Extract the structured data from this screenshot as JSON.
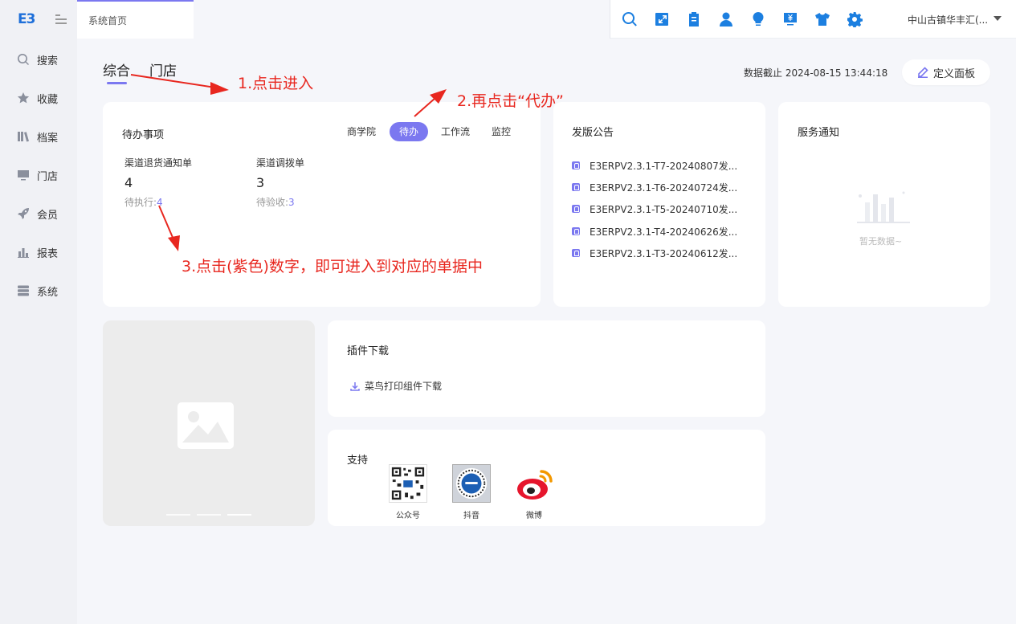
{
  "sidebar": {
    "logo": "E3",
    "items": [
      {
        "label": "搜索",
        "icon": "search-icon"
      },
      {
        "label": "收藏",
        "icon": "star-icon"
      },
      {
        "label": "档案",
        "icon": "books-icon"
      },
      {
        "label": "门店",
        "icon": "monitor-icon"
      },
      {
        "label": "会员",
        "icon": "rocket-icon"
      },
      {
        "label": "报表",
        "icon": "bar-chart-icon"
      },
      {
        "label": "系统",
        "icon": "server-icon"
      }
    ]
  },
  "topbar": {
    "tab_label": "系统首页",
    "icons": [
      "search-icon",
      "expand-icon",
      "clipboard-icon",
      "user-icon",
      "lightbulb-icon",
      "yen-monitor-icon",
      "shirt-icon",
      "gear-icon"
    ],
    "user_name": "中山古镇华丰汇(..."
  },
  "header": {
    "tabs": [
      "综合",
      "门店"
    ],
    "data_time": "数据截止 2024-08-15 13:44:18",
    "define_button": "定义面板"
  },
  "todo": {
    "title": "待办事项",
    "tabs": [
      "商学院",
      "待办",
      "工作流",
      "监控"
    ],
    "active_tab": "待办",
    "stats": [
      {
        "label": "渠道退货通知单",
        "value": "4",
        "sub_label": "待执行:",
        "sub_value": "4"
      },
      {
        "label": "渠道调拨单",
        "value": "3",
        "sub_label": "待验收:",
        "sub_value": "3"
      }
    ]
  },
  "release": {
    "title": "发版公告",
    "items": [
      "E3ERPV2.3.1-T7-20240807发...",
      "E3ERPV2.3.1-T6-20240724发...",
      "E3ERPV2.3.1-T5-20240710发...",
      "E3ERPV2.3.1-T4-20240626发...",
      "E3ERPV2.3.1-T3-20240612发..."
    ]
  },
  "service": {
    "title": "服务通知",
    "empty_text": "暂无数据~"
  },
  "plugin": {
    "title": "插件下载",
    "link": "菜鸟打印组件下载"
  },
  "support": {
    "title": "支持",
    "items": [
      "公众号",
      "抖音",
      "微博"
    ]
  },
  "annotations": {
    "step1": "1.点击进入",
    "step2": "2.再点击“代办”",
    "step3": "3.点击(紫色)数字，即可进入到对应的单据中"
  },
  "colors": {
    "accent": "#7b78f0",
    "brand_blue": "#1c7fe0",
    "annotation_red": "#e8271f"
  }
}
